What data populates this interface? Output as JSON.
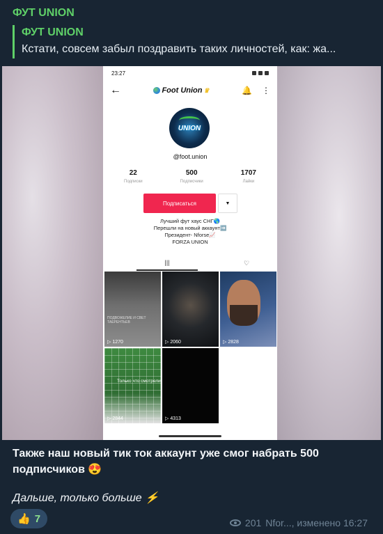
{
  "channel": {
    "name": "ФУТ UNION"
  },
  "reply": {
    "title": "ФУТ UNION",
    "text": "Кстати, совсем забыл поздравить таких личностей, как: жа..."
  },
  "phone": {
    "status_time": "23:27",
    "nav_title": "Foot Union",
    "handle": "@foot.union",
    "stats": [
      {
        "num": "22",
        "label": "Подписки"
      },
      {
        "num": "500",
        "label": "Подписчики"
      },
      {
        "num": "1707",
        "label": "Лайки"
      }
    ],
    "follow_label": "Подписаться",
    "bio": [
      "Лучший фут хаус СНГ🌎",
      "Перешли на новый аккаунт➡️",
      "Президент- Nforse📈",
      "FORZA UNION"
    ],
    "videos": [
      {
        "views": "1270",
        "overlay": "ПОДВОЖЕЛИЕ И СВЕТ ТАЕРЕНТЬЕВ"
      },
      {
        "views": "2060"
      },
      {
        "views": "2828"
      },
      {
        "views": "2844",
        "overlay": "Только что смотрели"
      },
      {
        "views": "4313"
      }
    ]
  },
  "message": {
    "caption": "Также наш новый тик ток аккаунт уже смог набрать 500 подписчиков 😍",
    "sub": "Дальше, только больше ⚡"
  },
  "reaction": {
    "emoji": "👍",
    "count": "7"
  },
  "meta": {
    "views": "201",
    "author_edited": "Nfor..., изменено 16:27"
  },
  "colors": {
    "accent": "#5fd068",
    "bg": "#182533",
    "follow": "#f0264f"
  }
}
